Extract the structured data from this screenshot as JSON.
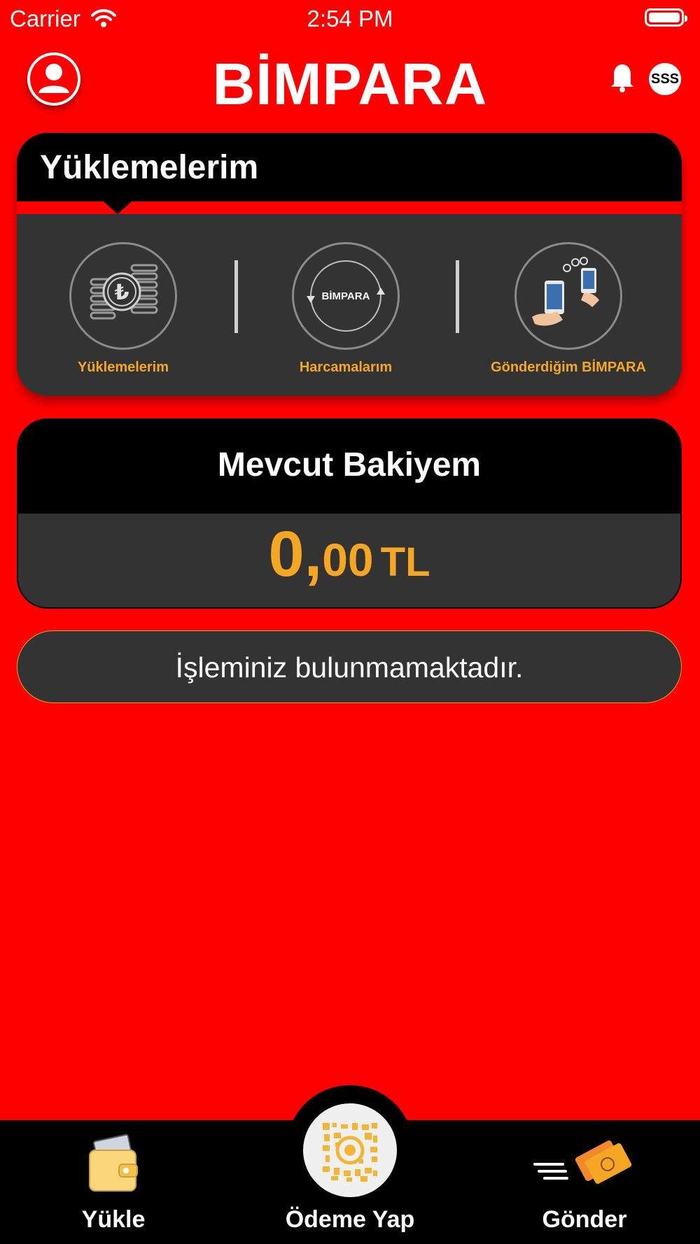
{
  "status_bar": {
    "carrier": "Carrier",
    "time": "2:54 PM"
  },
  "header": {
    "logo": "BİMPARA",
    "faq_label": "SSS"
  },
  "uploads_card": {
    "title": "Yüklemelerim",
    "items": [
      {
        "label": "Yüklemelerim",
        "icon": "coins-lira-icon"
      },
      {
        "label": "Harcamalarım",
        "icon": "bimpara-cycle-icon",
        "icon_text": "BİMPARA"
      },
      {
        "label": "Gönderdiğim BİMPARA",
        "icon": "phone-transfer-icon"
      }
    ]
  },
  "balance_card": {
    "title": "Mevcut Bakiyem",
    "amount_int": "0,",
    "amount_dec": "00",
    "currency": "TL"
  },
  "transactions": {
    "empty_message": "İşleminiz bulunmamaktadır."
  },
  "bottom_nav": {
    "items": [
      {
        "label": "Yükle",
        "icon": "wallet-icon"
      },
      {
        "label": "Ödeme Yap",
        "icon": "qr-code-icon"
      },
      {
        "label": "Gönder",
        "icon": "send-card-icon"
      }
    ]
  },
  "colors": {
    "background": "#ff0000",
    "accent": "#f5a623",
    "card": "#333333",
    "header": "#000000"
  }
}
